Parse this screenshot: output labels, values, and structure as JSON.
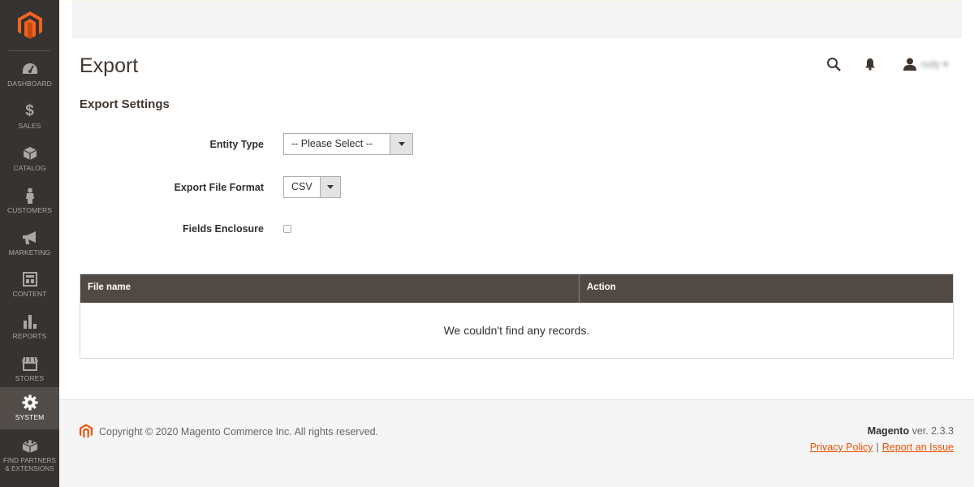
{
  "sidebar": {
    "logo": "magento-logo",
    "items": [
      {
        "label": "Dashboard",
        "icon": "dashboard-icon",
        "active": false
      },
      {
        "label": "Sales",
        "icon": "dollar-icon",
        "active": false
      },
      {
        "label": "Catalog",
        "icon": "box-icon",
        "active": false
      },
      {
        "label": "Customers",
        "icon": "person-icon",
        "active": false
      },
      {
        "label": "Marketing",
        "icon": "megaphone-icon",
        "active": false
      },
      {
        "label": "Content",
        "icon": "layout-icon",
        "active": false
      },
      {
        "label": "Reports",
        "icon": "bar-chart-icon",
        "active": false
      },
      {
        "label": "Stores",
        "icon": "storefront-icon",
        "active": false
      },
      {
        "label": "System",
        "icon": "gear-icon",
        "active": true
      },
      {
        "label": "Find Partners & Extensions",
        "icon": "blocks-icon",
        "active": false
      }
    ]
  },
  "header": {
    "title": "Export",
    "user_name": "rudy",
    "search_icon": "search-icon",
    "notifications_icon": "bell-icon",
    "user_icon": "user-icon"
  },
  "section": {
    "title": "Export Settings"
  },
  "form": {
    "entity_type": {
      "label": "Entity Type",
      "value": "-- Please Select --"
    },
    "file_format": {
      "label": "Export File Format",
      "value": "CSV"
    },
    "fields_enclosure": {
      "label": "Fields Enclosure",
      "checked": false
    }
  },
  "grid": {
    "columns": [
      "File name",
      "Action"
    ],
    "rows": [],
    "empty_message": "We couldn't find any records."
  },
  "footer": {
    "copyright": "Copyright © 2020 Magento Commerce Inc. All rights reserved.",
    "brand": "Magento",
    "version": "ver. 2.3.3",
    "privacy_link": "Privacy Policy",
    "separator": "|",
    "report_link": "Report an Issue"
  },
  "colors": {
    "sidebar_bg": "#373330",
    "sidebar_active_bg": "#524d49",
    "brand_orange": "#eb5202",
    "grid_header_bg": "#514943"
  }
}
